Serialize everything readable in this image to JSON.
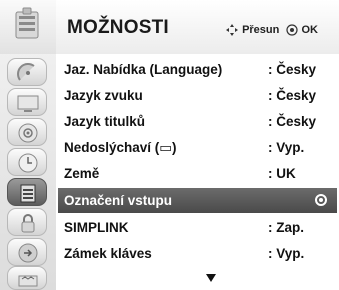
{
  "header": {
    "title": "MOŽNOSTI",
    "hint_move": "Přesun",
    "hint_ok": "OK"
  },
  "menu": {
    "items": [
      {
        "label": "Jaz. Nabídka (Language)",
        "value": ": Česky"
      },
      {
        "label": "Jazyk zvuku",
        "value": ": Česky"
      },
      {
        "label": "Jazyk titulků",
        "value": ": Česky"
      },
      {
        "label": "Nedoslýchaví (▭)",
        "value": ": Vyp."
      },
      {
        "label": "Země",
        "value": ": UK"
      },
      {
        "label": "Označení vstupu",
        "value": ""
      },
      {
        "label": "SIMPLINK",
        "value": ": Zap."
      },
      {
        "label": "Zámek kláves",
        "value": ": Vyp."
      }
    ],
    "selected_index": 5
  },
  "sidebar": {
    "icons": [
      "satellite-dish-icon",
      "picture-icon",
      "audio-icon",
      "clock-icon",
      "options-icon",
      "lock-icon",
      "input-icon",
      "usb-icon"
    ],
    "active_icon": "options-icon"
  }
}
